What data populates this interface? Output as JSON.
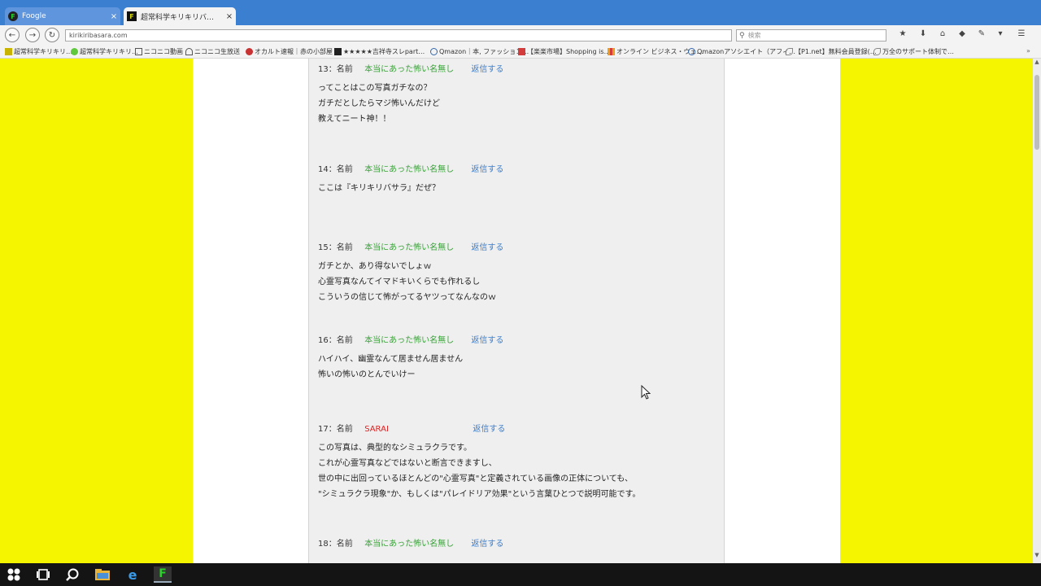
{
  "browser": {
    "tabs": [
      {
        "label": "Foogle",
        "favicon": "F",
        "active": false
      },
      {
        "label": "超常科学キリキリバ…",
        "favicon": "F",
        "active": true
      }
    ],
    "close_glyph": "×",
    "url": "kirikiribasara.com",
    "search_placeholder": "検索",
    "back_glyph": "←",
    "forward_glyph": "→",
    "reload_glyph": "↻"
  },
  "bookmarks": [
    {
      "label": "超常科学キリキリ…",
      "icon": "kiri-icon",
      "color": "#c8b400"
    },
    {
      "label": "超常科学キリキリ…",
      "icon": "heart-icon",
      "color": "#5fc83c"
    },
    {
      "label": "ニコニコ動画",
      "icon": "tv-icon",
      "color": "#555555"
    },
    {
      "label": "ニコニコ生放送",
      "icon": "cloud-icon",
      "color": "#555555"
    },
    {
      "label": "オカルト速報｜赤の小部屋",
      "icon": "bird-icon",
      "color": "#c83232"
    },
    {
      "label": "★★★★★吉祥寺スレpart…",
      "icon": "tag-icon",
      "color": "#222222"
    },
    {
      "label": "Qmazon｜本, ファッション…",
      "icon": "user-icon",
      "color": "#3366aa"
    },
    {
      "label": "【楽楽市場】Shopping is…",
      "icon": "box-icon",
      "color": "#d23c3c"
    },
    {
      "label": "オンライン ビジネス・ウェ…",
      "icon": "stripe-icon",
      "color": "#e8a020"
    },
    {
      "label": "Qmazonアソシエイト（アフィ…",
      "icon": "user-icon",
      "color": "#3366aa"
    },
    {
      "label": "【P1.net】無料会員登録(…",
      "icon": "leaf-icon",
      "color": "#888888"
    },
    {
      "label": "万全のサポート体制で…",
      "icon": "leaf-icon",
      "color": "#888888"
    }
  ],
  "page": {
    "name_label": "名前",
    "reply_label": "返信する",
    "posts": [
      {
        "num": "13：",
        "name": "本当にあった怖い名無し",
        "red": false,
        "lines": [
          "ってことはこの写真ガチなの？",
          "ガチだとしたらマジ怖いんだけど",
          "教えてニート神！！"
        ]
      },
      {
        "num": "14：",
        "name": "本当にあった怖い名無し",
        "red": false,
        "lines": [
          "ここは『キリキリバサラ』だぜ？"
        ]
      },
      {
        "num": "15：",
        "name": "本当にあった怖い名無し",
        "red": false,
        "lines": [
          "ガチとか、あり得ないでしょｗ",
          "心霊写真なんてイマドキいくらでも作れるし",
          "こういうの信じて怖がってるヤツってなんなのｗ"
        ]
      },
      {
        "num": "16：",
        "name": "本当にあった怖い名無し",
        "red": false,
        "lines": [
          "ハイハイ、幽霊なんて居ません居ません",
          "怖いの怖いのとんでいけー"
        ]
      },
      {
        "num": "17：",
        "name": "SARAI",
        "red": true,
        "lines": [
          "この写真は、典型的なシミュラクラです。",
          "これが心霊写真などではないと断言できますし、",
          "世の中に出回っているほとんどの\"心霊写真\"と定義されている画像の正体についても、",
          "\"シミュラクラ現象\"か、もしくは\"パレイドリア効果\"という言葉ひとつで説明可能です。"
        ]
      },
      {
        "num": "18：",
        "name": "本当にあった怖い名無し",
        "red": false,
        "lines": []
      }
    ]
  },
  "colors": {
    "background": "#f5f500",
    "tabstrip": "#3b7fd0",
    "name_green": "#3aa23a",
    "name_red": "#e02020",
    "reply_blue": "#3b7fcf"
  }
}
